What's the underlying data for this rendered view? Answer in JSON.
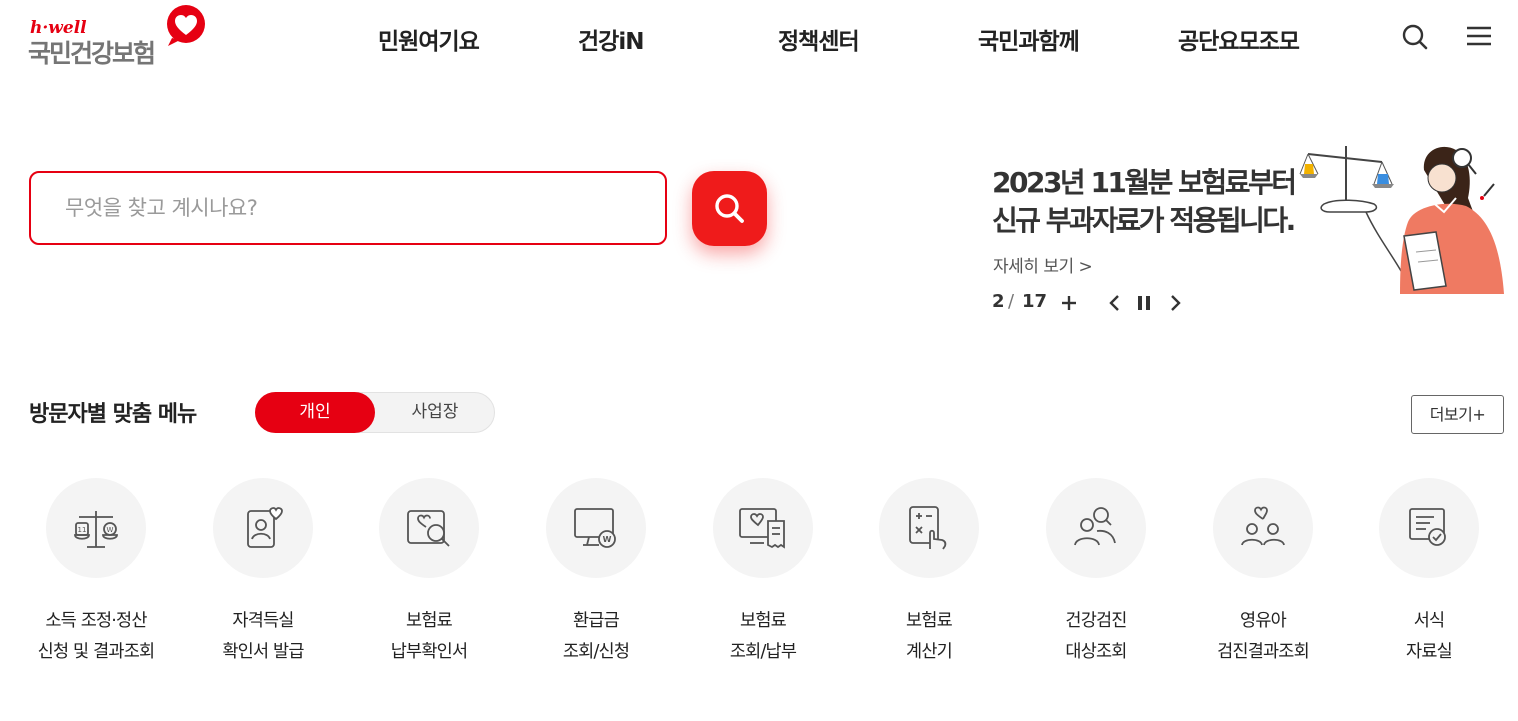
{
  "logo": {
    "tagline": "h·well",
    "name": "국민건강보험"
  },
  "nav": {
    "items": [
      "민원여기요",
      "건강iN",
      "정책센터",
      "국민과함께",
      "공단요모조모"
    ]
  },
  "header_icons": {
    "search": "search-icon",
    "menu": "hamburger-menu-icon"
  },
  "search": {
    "placeholder": "무엇을 찾고 계시나요?",
    "button_icon": "search-icon"
  },
  "banner": {
    "headline_line1": "2023년 11월분 보험료부터",
    "headline_line2": "신규 부과자료가 적용됩니다.",
    "more_label": "자세히 보기 >",
    "current": "2",
    "separator": "/",
    "total": "17",
    "controls": [
      "plus-icon",
      "prev-arrow-icon",
      "pause-icon",
      "next-arrow-icon"
    ]
  },
  "visitor_menu": {
    "title": "방문자별 맞춤 메뉴",
    "toggle": {
      "active": "개인",
      "inactive": "사업장"
    },
    "more_label": "더보기+",
    "items": [
      {
        "icon": "scale-won-icon",
        "line1": "소득 조정·정산",
        "line2": "신청 및 결과조회"
      },
      {
        "icon": "profile-heart-icon",
        "line1": "자격득실",
        "line2": "확인서 발급"
      },
      {
        "icon": "insurance-search-icon",
        "line1": "보험료",
        "line2": "납부확인서"
      },
      {
        "icon": "monitor-won-icon",
        "line1": "환급금",
        "line2": "조회/신청"
      },
      {
        "icon": "monitor-receipt-icon",
        "line1": "보험료",
        "line2": "조회/납부"
      },
      {
        "icon": "calculator-hand-icon",
        "line1": "보험료",
        "line2": "계산기"
      },
      {
        "icon": "people-search-icon",
        "line1": "건강검진",
        "line2": "대상조회"
      },
      {
        "icon": "family-heart-icon",
        "line1": "영유아",
        "line2": "검진결과조회"
      },
      {
        "icon": "document-check-icon",
        "line1": "서식",
        "line2": "자료실"
      }
    ]
  },
  "colors": {
    "brand": "#e60012",
    "accent_button": "#ef1b1b",
    "icon_stroke": "#555555",
    "circle_bg": "#f4f4f4"
  }
}
